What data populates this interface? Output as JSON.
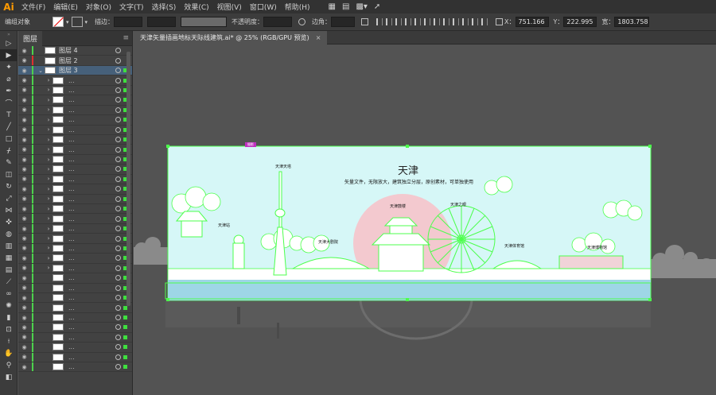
{
  "app": {
    "logo": "Ai"
  },
  "menu": [
    "文件(F)",
    "编辑(E)",
    "对象(O)",
    "文字(T)",
    "选择(S)",
    "效果(C)",
    "视图(V)",
    "窗口(W)",
    "帮助(H)"
  ],
  "control_bar": {
    "group_label": "编组对象",
    "stroke_label": "描边：",
    "opacity_label": "不透明度：",
    "corner_label": "边角：",
    "x_label": "X：",
    "x_value": "751.166",
    "y_label": "Y：",
    "y_value": "222.995",
    "w_label": "宽：",
    "w_value": "1803.758"
  },
  "layers_panel": {
    "tab_label": "图层",
    "layers": [
      {
        "name": "图层 4",
        "color": "#4cd14c"
      },
      {
        "name": "图层 2",
        "color": "#e03030"
      },
      {
        "name": "图层 3",
        "color": "#4cd14c",
        "selected": true
      }
    ],
    "sub_item_dots": "..."
  },
  "document": {
    "tab_title": "天津矢量插画地标天际线建筑.ai* @ 25% (RGB/GPU 预览)",
    "close_glyph": "×"
  },
  "artwork": {
    "title": "天津",
    "subtitle": "矢量文件，无限放大，建筑独立分层，原创素材，可单独使用",
    "labels": [
      "天津天塔",
      "天津站",
      "天津鼓楼",
      "天津之眼",
      "天津大剧院",
      "天津体育馆",
      "天津博物馆"
    ],
    "tag": "摄影"
  },
  "colors": {
    "selection": "#4cff4c",
    "sky": "#d6f7f7",
    "menubar": "#323232",
    "panel": "#424242",
    "canvas": "#535353"
  }
}
